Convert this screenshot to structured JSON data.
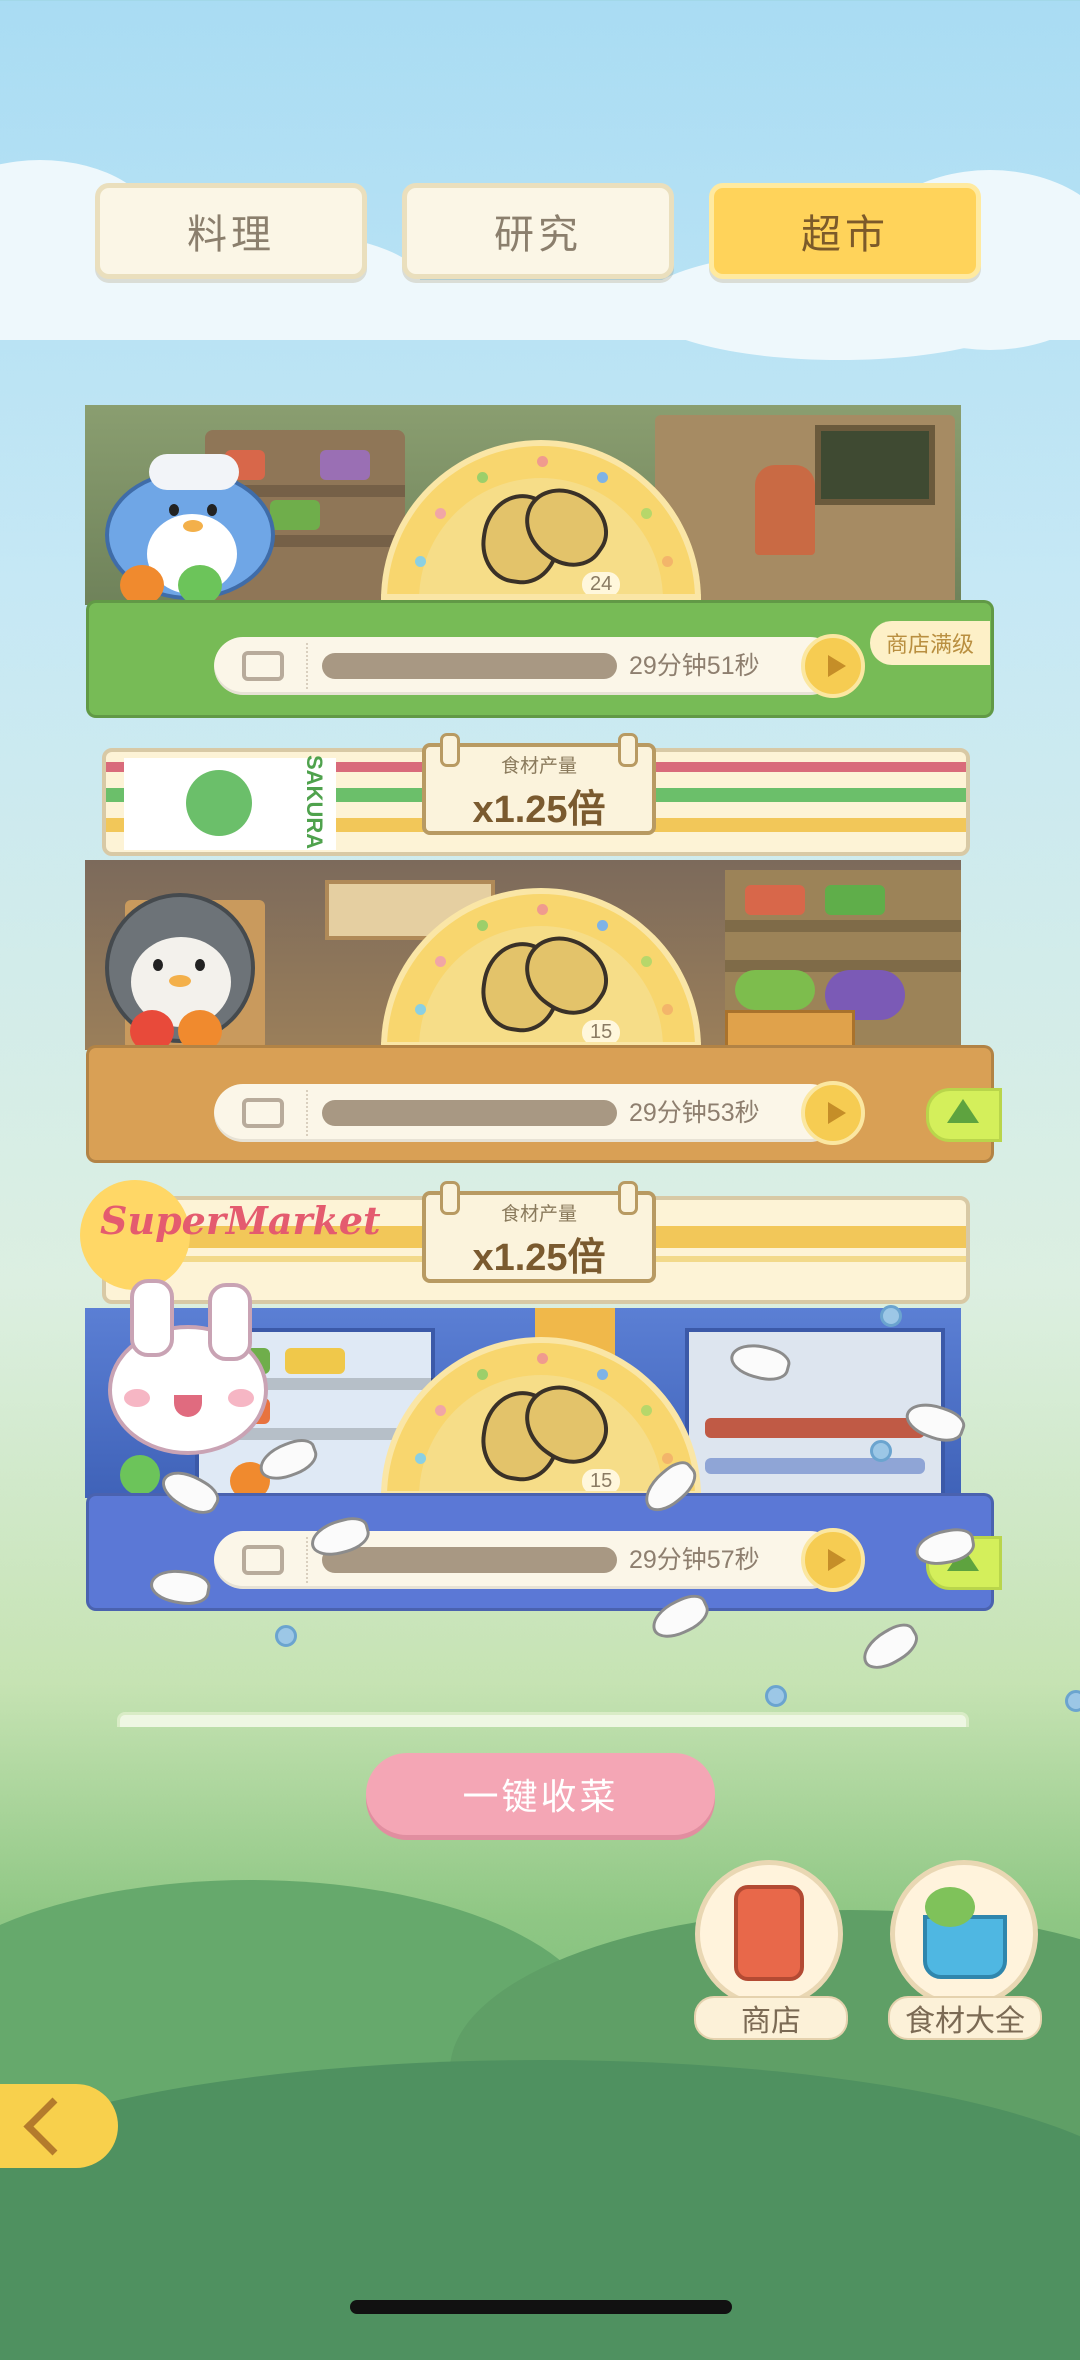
{
  "tabs": [
    {
      "label": "料理",
      "active": false
    },
    {
      "label": "研究",
      "active": false
    },
    {
      "label": "超市",
      "active": true
    }
  ],
  "shops": [
    {
      "item_icon": "potato-icon",
      "item_count": "24",
      "timer": "29分钟51秒",
      "progress": 0.95,
      "status_tag": "商店满级",
      "theme_color": "#7cbf5e",
      "mascot": "blue-penguin"
    },
    {
      "banner_brand": "SAKURA",
      "multiplier_label": "食材产量",
      "multiplier_value": "x1.25倍",
      "item_icon": "potato-icon",
      "item_count": "15",
      "timer": "29分钟53秒",
      "progress": 0.95,
      "theme_color": "#d9a055",
      "mascot": "gray-penguin"
    },
    {
      "banner_brand": "SuperMarket",
      "multiplier_label": "食材产量",
      "multiplier_value": "x1.25倍",
      "item_icon": "potato-icon",
      "item_count": "15",
      "timer": "29分钟57秒",
      "progress": 0.95,
      "theme_color": "#5b78d6",
      "mascot": "pink-bunny"
    }
  ],
  "actions": {
    "collect_all_label": "一键收菜",
    "shop_label": "商店",
    "ingredients_label": "食材大全"
  },
  "colors": {
    "tab_active": "#ffd35a",
    "collect_button": "#f4a6b5"
  }
}
